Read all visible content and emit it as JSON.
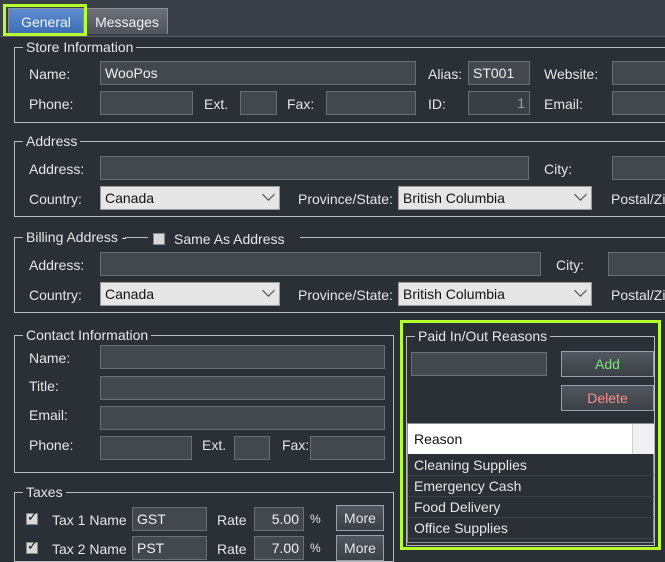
{
  "tabs": [
    {
      "label": "General"
    },
    {
      "label": "Messages"
    }
  ],
  "store": {
    "legend": "Store Information",
    "name_label": "Name:",
    "name_value": "WooPos",
    "alias_label": "Alias:",
    "alias_value": "ST001",
    "website_label": "Website:",
    "phone_label": "Phone:",
    "ext_label": "Ext.",
    "fax_label": "Fax:",
    "id_label": "ID:",
    "id_value": "1",
    "email_label": "Email:"
  },
  "address": {
    "legend": "Address",
    "address_label": "Address:",
    "city_label": "City:",
    "country_label": "Country:",
    "country_value": "Canada",
    "province_label": "Province/State:",
    "province_value": "British Columbia",
    "postal_label": "Postal/Zi"
  },
  "billing": {
    "legend": "Billing Address -",
    "same_label": "Same As Address",
    "address_label": "Address:",
    "city_label": "City:",
    "country_label": "Country:",
    "country_value": "Canada",
    "province_label": "Province/State:",
    "province_value": "British Columbia",
    "postal_label": "Postal/Zi"
  },
  "contact": {
    "legend": "Contact Information",
    "name_label": "Name:",
    "title_label": "Title:",
    "email_label": "Email:",
    "phone_label": "Phone:",
    "ext_label": "Ext.",
    "fax_label": "Fax:"
  },
  "taxes": {
    "legend": "Taxes",
    "rows": [
      {
        "name_label": "Tax 1 Name",
        "name_value": "GST",
        "rate_label": "Rate",
        "rate_value": "5.00",
        "pct": "%",
        "more": "More"
      },
      {
        "name_label": "Tax 2 Name",
        "name_value": "PST",
        "rate_label": "Rate",
        "rate_value": "7.00",
        "pct": "%",
        "more": "More"
      }
    ]
  },
  "paid": {
    "legend": "Paid In/Out Reasons",
    "add_label": "Add",
    "delete_label": "Delete",
    "column": "Reason",
    "items": [
      "Cleaning Supplies",
      "Emergency Cash",
      "Food Delivery",
      "Office Supplies"
    ]
  },
  "colors": {
    "highlight": "#b6ff2e",
    "add_text": "#7ee07e",
    "delete_text": "#ff8a8a"
  }
}
